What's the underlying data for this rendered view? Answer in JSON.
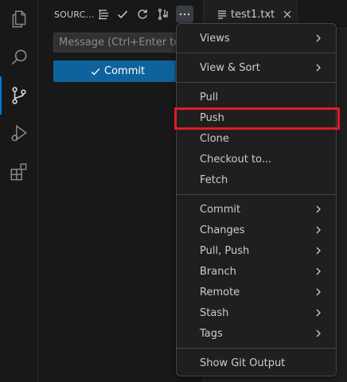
{
  "activity_bar": {
    "items": [
      {
        "icon": "explorer-icon"
      },
      {
        "icon": "search-icon"
      },
      {
        "icon": "source-control-icon",
        "active": true
      },
      {
        "icon": "run-debug-icon"
      },
      {
        "icon": "extensions-icon"
      }
    ]
  },
  "source_control": {
    "title": "SOURC...",
    "actions": [
      "view-as-tree-icon",
      "check-icon",
      "refresh-icon",
      "branch-icon",
      "more-actions-icon"
    ],
    "message_placeholder": "Message (Ctrl+Enter to commit)",
    "commit_label": "Commit"
  },
  "editor": {
    "tab_label": "test1.txt"
  },
  "menu": {
    "groups": [
      [
        {
          "label": "Views",
          "submenu": true
        }
      ],
      [
        {
          "label": "View & Sort",
          "submenu": true
        }
      ],
      [
        {
          "label": "Pull",
          "submenu": false
        },
        {
          "label": "Push",
          "submenu": false,
          "highlighted": true
        },
        {
          "label": "Clone",
          "submenu": false
        },
        {
          "label": "Checkout to...",
          "submenu": false
        },
        {
          "label": "Fetch",
          "submenu": false
        }
      ],
      [
        {
          "label": "Commit",
          "submenu": true
        },
        {
          "label": "Changes",
          "submenu": true
        },
        {
          "label": "Pull, Push",
          "submenu": true
        },
        {
          "label": "Branch",
          "submenu": true
        },
        {
          "label": "Remote",
          "submenu": true
        },
        {
          "label": "Stash",
          "submenu": true
        },
        {
          "label": "Tags",
          "submenu": true
        }
      ],
      [
        {
          "label": "Show Git Output",
          "submenu": false
        }
      ]
    ]
  },
  "colors": {
    "accent": "#0078d4",
    "commit_button": "#0e639c",
    "highlight": "#e21b23"
  }
}
